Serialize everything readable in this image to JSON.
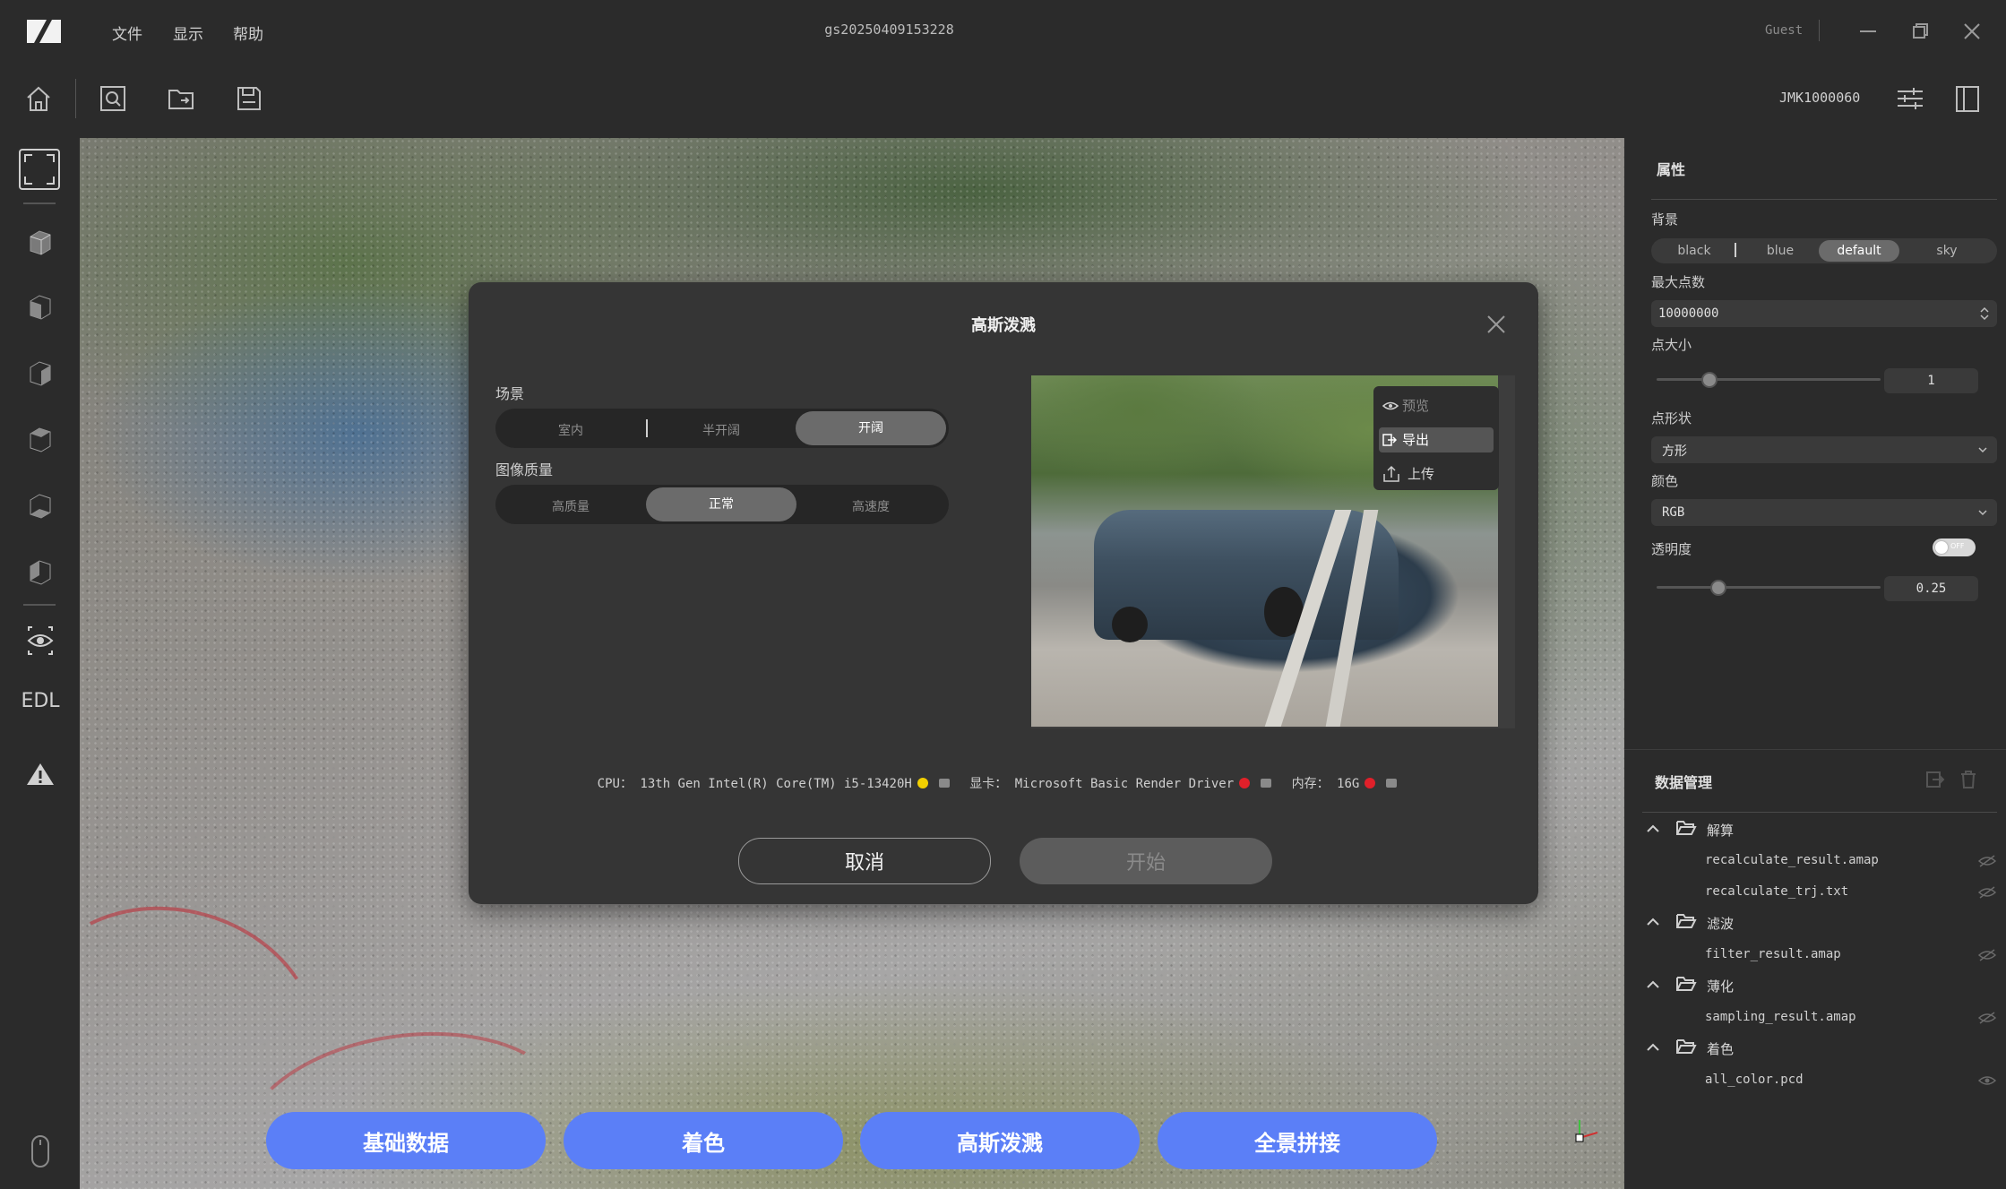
{
  "titlebar": {
    "menu": [
      "文件",
      "显示",
      "帮助"
    ],
    "doc_title": "gs20250409153228",
    "user": "Guest"
  },
  "toolbar": {
    "buttons": [
      "home-icon",
      "search-file-icon",
      "open-folder-icon",
      "save-icon"
    ],
    "device_id": "JMK1000060"
  },
  "leftbar": {
    "icons": [
      "fit-view-icon",
      "cube-view-icon",
      "front-view-icon",
      "left-view-icon",
      "right-view-icon",
      "top-view-icon",
      "bottom-view-icon",
      "eye-icon",
      "edl-icon",
      "warning-icon",
      "mouse-icon"
    ],
    "edl_label": "EDL"
  },
  "bottom_actions": [
    "基础数据",
    "着色",
    "高斯泼溅",
    "全景拼接"
  ],
  "properties": {
    "title": "属性",
    "background_label": "背景",
    "background_options": [
      "black",
      "blue",
      "default",
      "sky"
    ],
    "background_selected": "default",
    "max_points_label": "最大点数",
    "max_points_value": "10000000",
    "point_size_label": "点大小",
    "point_size_value": "1",
    "point_shape_label": "点形状",
    "point_shape_value": "方形",
    "color_label": "颜色",
    "color_value": "RGB",
    "opacity_label": "透明度",
    "opacity_toggle": "OFF",
    "opacity_value": "0.25"
  },
  "data_management": {
    "title": "数据管理",
    "groups": [
      {
        "name": "解算",
        "files": [
          "recalculate_result.amap",
          "recalculate_trj.txt"
        ]
      },
      {
        "name": "滤波",
        "files": [
          "filter_result.amap"
        ]
      },
      {
        "name": "薄化",
        "files": [
          "sampling_result.amap"
        ]
      },
      {
        "name": "着色",
        "files": [
          "all_color.pcd"
        ]
      }
    ]
  },
  "modal": {
    "title": "高斯泼溅",
    "scene_label": "场景",
    "scene_options": [
      "室内",
      "半开阔",
      "开阔"
    ],
    "scene_selected": "开阔",
    "quality_label": "图像质量",
    "quality_options": [
      "高质量",
      "正常",
      "高速度"
    ],
    "quality_selected": "正常",
    "context_menu": [
      "预览",
      "导出",
      "上传"
    ],
    "context_menu_active": "导出",
    "cpu_label": "CPU：",
    "cpu_value": "13th Gen Intel(R) Core(TM) i5-13420H",
    "gpu_label": "显卡：",
    "gpu_value": "Microsoft Basic Render Driver",
    "mem_label": "内存：",
    "mem_value": "16G",
    "cancel": "取消",
    "start": "开始"
  },
  "colors": {
    "accent_blue": "#5b7ff7",
    "status_yellow": "#f2d000",
    "status_red": "#e0202a"
  }
}
